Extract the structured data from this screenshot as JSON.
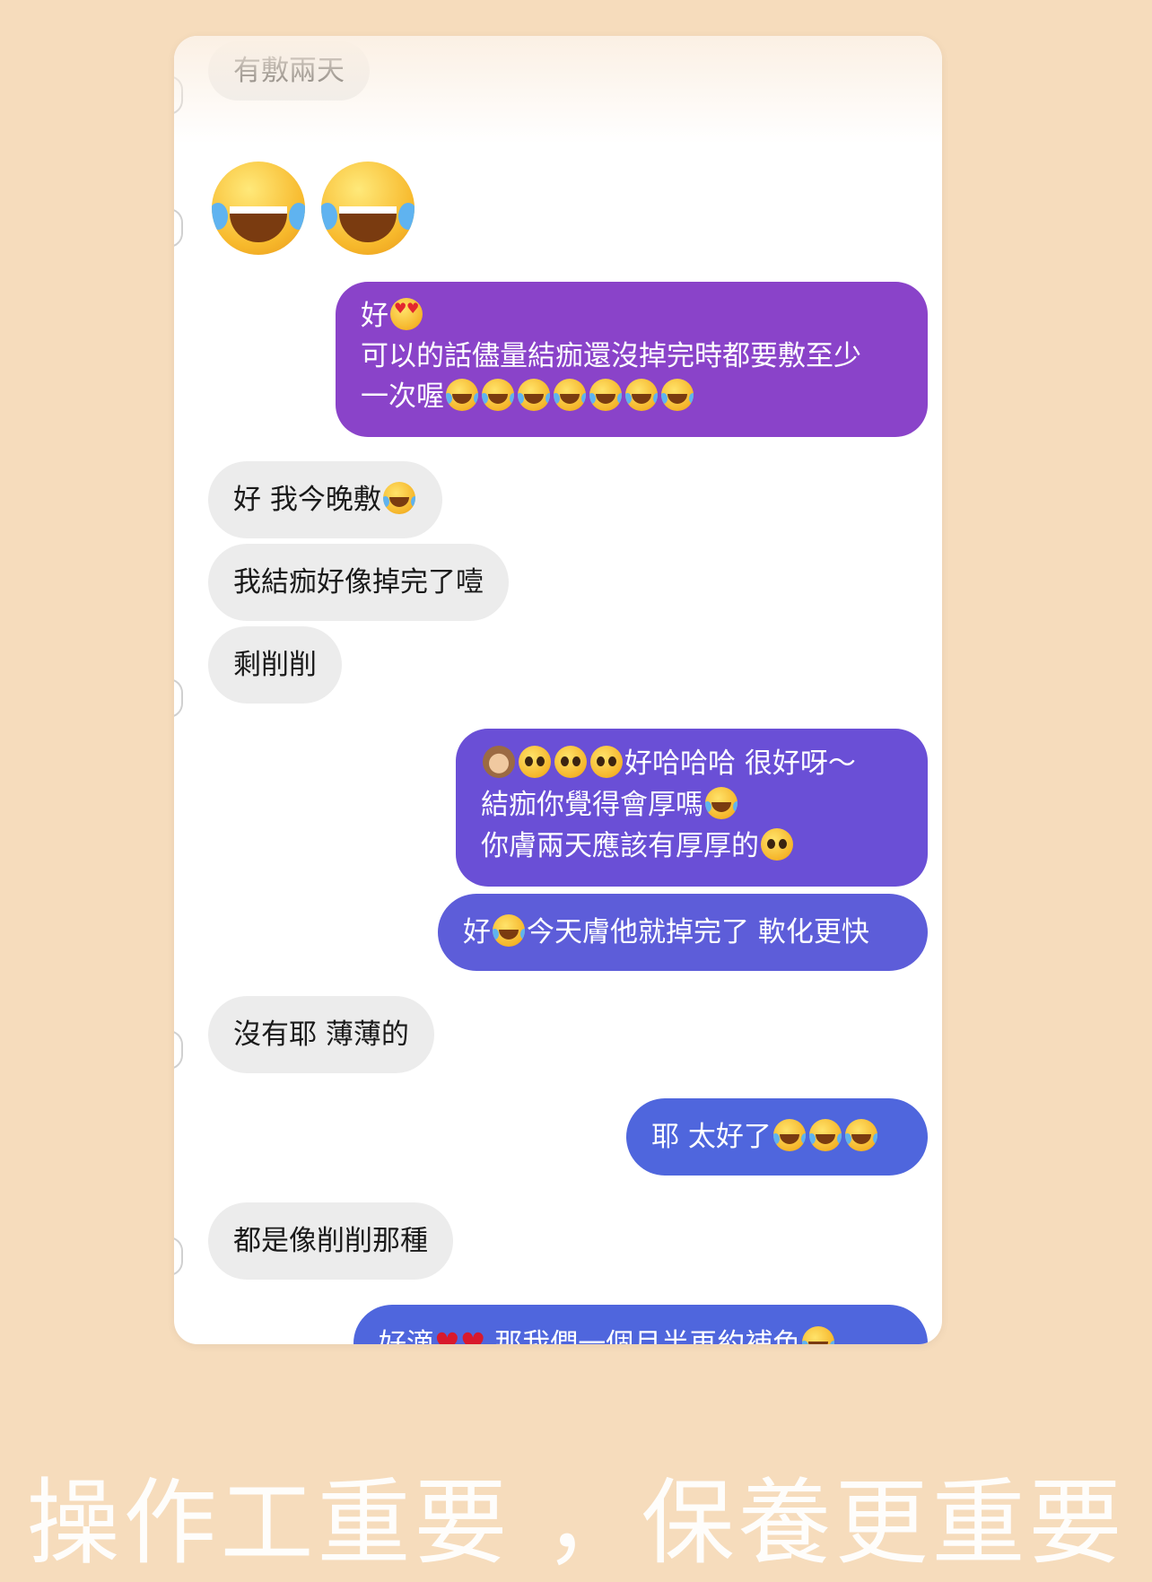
{
  "chat": {
    "m1": "有敷兩天",
    "m3_line1": "好",
    "m3_line2": "可以的話儘量結痂還沒掉完時都要敷至少",
    "m3_line3": "一次喔",
    "m4": "好 我今晚敷",
    "m5": "我結痂好像掉完了噎",
    "m6": "剩削削",
    "m7_line1": "好哈哈哈 很好呀～",
    "m7_line2": "結痂你覺得會厚嗎",
    "m7_line3": "你膚兩天應該有厚厚的",
    "m8a": "好",
    "m8b": "今天膚他就掉完了 軟化更快",
    "m9": "沒有耶 薄薄的",
    "m10": "耶 太好了",
    "m11": "都是像削削那種",
    "m12a": "好滴",
    "m12b": "那我們一個月半再約補色"
  },
  "caption": "操作工重要 ，保養更重要",
  "colors": {
    "background": "#f6dcbc",
    "incoming_bubble": "#ececec",
    "outgoing_purple": "#8a43c9",
    "outgoing_blue": "#4f66dd"
  },
  "icons": [
    "face-with-tears-of-joy-icon",
    "heart-eyes-icon",
    "pleading-face-icon",
    "see-no-evil-monkey-icon",
    "red-heart-icon"
  ]
}
